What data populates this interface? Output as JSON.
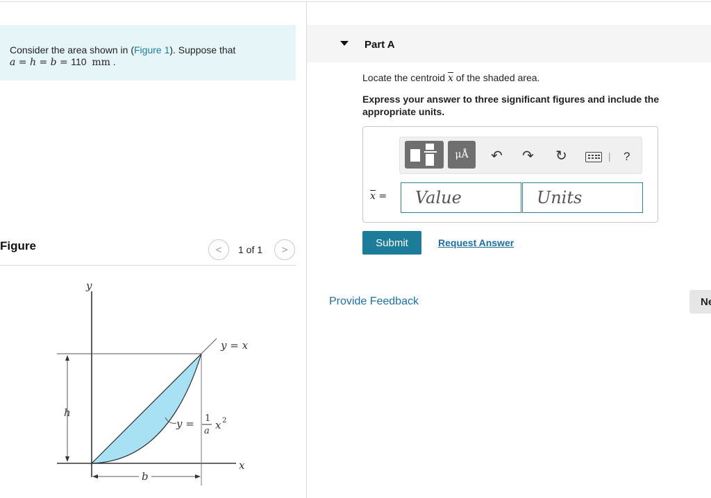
{
  "problem": {
    "prefix": "Consider the area shown in (",
    "figure_link": "Figure 1",
    "suffix": "). Suppose that",
    "equation": "a = h = b = ",
    "value": "110",
    "unit": "mm",
    "period": "."
  },
  "figure": {
    "label": "Figure",
    "counter": "1 of 1",
    "prev_icon": "chevron-left-icon",
    "next_icon": "chevron-right-icon",
    "prev_glyph": "<",
    "next_glyph": ">",
    "diagram": {
      "y_axis": "y",
      "x_axis": "x",
      "line_label": "y = x",
      "curve_label_lhs": "y =",
      "curve_numerator": "1",
      "curve_denominator": "a",
      "curve_var": "x",
      "curve_exp": "2",
      "h_label": "h",
      "b_label": "b"
    },
    "colors": {
      "shaded": "#a8e0f4"
    }
  },
  "part": {
    "title": "Part A",
    "toggle_icon": "caret-down-icon",
    "question_prefix": "Locate the centroid ",
    "question_var": "x",
    "question_suffix": " of the shaded area.",
    "instructions": "Express your answer to three significant figures and include the appropriate units."
  },
  "toolbar": {
    "template_icon": "fraction-template-icon",
    "units_label": "μÅ",
    "undo_icon": "undo-icon",
    "undo_glyph": "↶",
    "redo_icon": "redo-icon",
    "redo_glyph": "↷",
    "reset_icon": "reset-icon",
    "reset_glyph": "↻",
    "keyboard_icon": "keyboard-icon",
    "separator": "|",
    "help_glyph": "?"
  },
  "answer": {
    "var": "x",
    "equals": " =",
    "value_placeholder": "Value",
    "units_placeholder": "Units"
  },
  "actions": {
    "submit": "Submit",
    "request_answer": "Request Answer",
    "feedback": "Provide Feedback",
    "next": "Next"
  },
  "colors": {
    "accent": "#1d7c99",
    "link": "#1d6fa5",
    "problem_bg": "#e6f5f7"
  }
}
